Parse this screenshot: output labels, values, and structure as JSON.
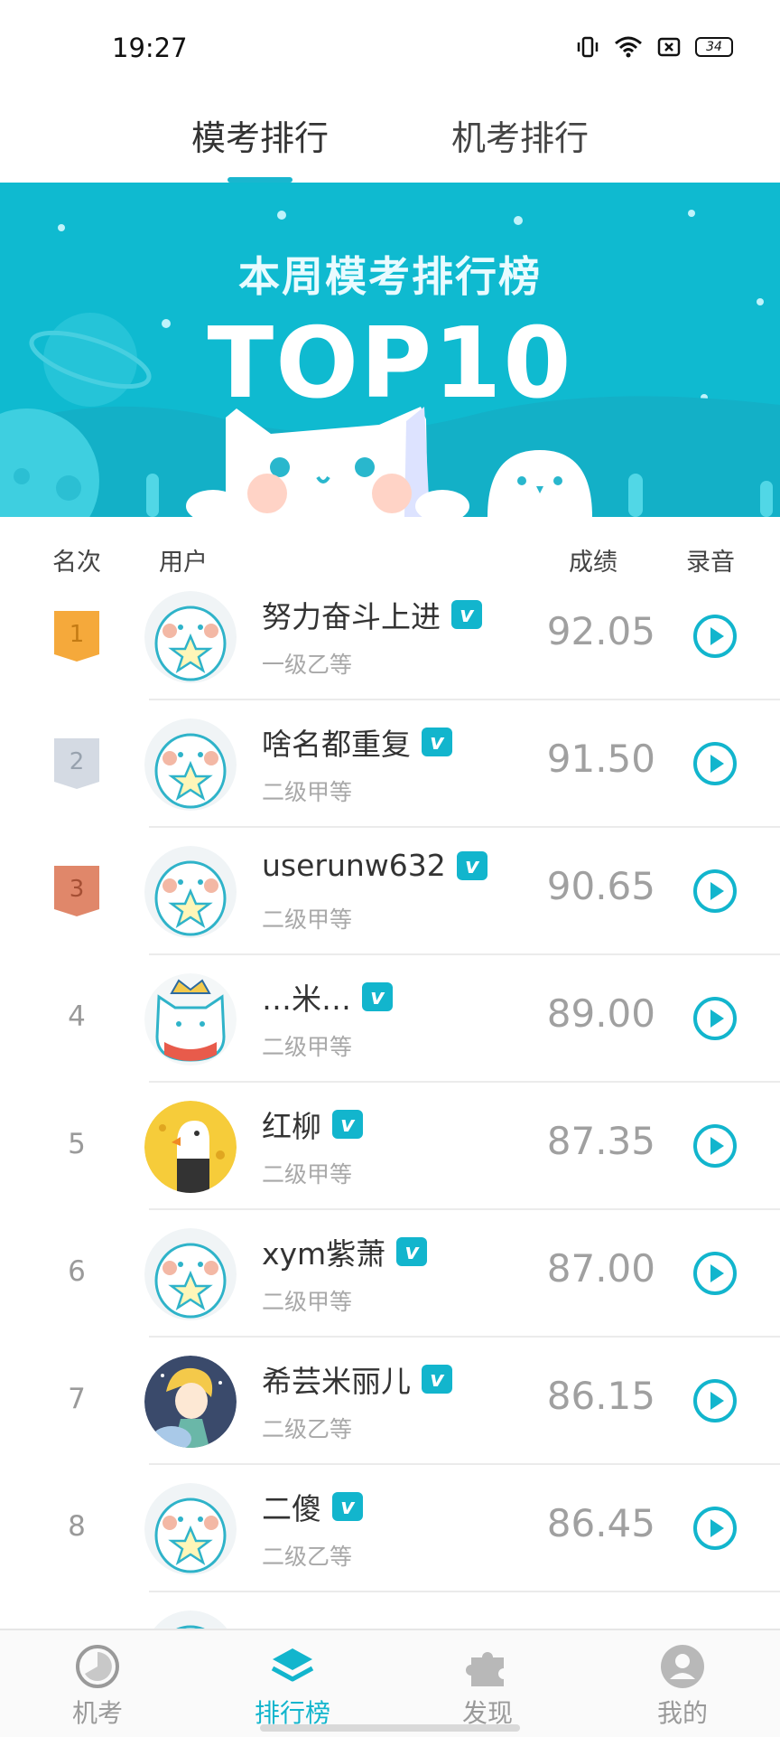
{
  "status": {
    "time": "19:27",
    "battery": "34"
  },
  "tabs": [
    {
      "label": "模考排行"
    },
    {
      "label": "机考排行"
    }
  ],
  "banner": {
    "subtitle": "本周模考排行榜",
    "title": "TOP10"
  },
  "header": {
    "rank": "名次",
    "user": "用户",
    "score": "成绩",
    "audio": "录音"
  },
  "vip_badge": "v",
  "colors": {
    "accent": "#12b5cd",
    "gold": "#f5a93b",
    "silver": "#d4dae3",
    "bronze": "#e0876a"
  },
  "rows": [
    {
      "rank": "1",
      "name": "努力奋斗上进",
      "level": "一级乙等",
      "score": "92.05"
    },
    {
      "rank": "2",
      "name": "啥名都重复",
      "level": "二级甲等",
      "score": "91.50"
    },
    {
      "rank": "3",
      "name": "userunw632",
      "level": "二级甲等",
      "score": "90.65"
    },
    {
      "rank": "4",
      "name": "…米…",
      "level": "二级甲等",
      "score": "89.00"
    },
    {
      "rank": "5",
      "name": "红柳",
      "level": "二级甲等",
      "score": "87.35"
    },
    {
      "rank": "6",
      "name": "xym紫萧",
      "level": "二级甲等",
      "score": "87.00"
    },
    {
      "rank": "7",
      "name": "希芸米丽儿",
      "level": "二级乙等",
      "score": "86.15"
    },
    {
      "rank": "8",
      "name": "二傻",
      "level": "二级乙等",
      "score": "86.45"
    }
  ],
  "bottom_nav": [
    {
      "label": "机考",
      "icon": "clock-icon"
    },
    {
      "label": "排行榜",
      "icon": "layers-icon"
    },
    {
      "label": "发现",
      "icon": "puzzle-icon"
    },
    {
      "label": "我的",
      "icon": "user-icon"
    }
  ]
}
